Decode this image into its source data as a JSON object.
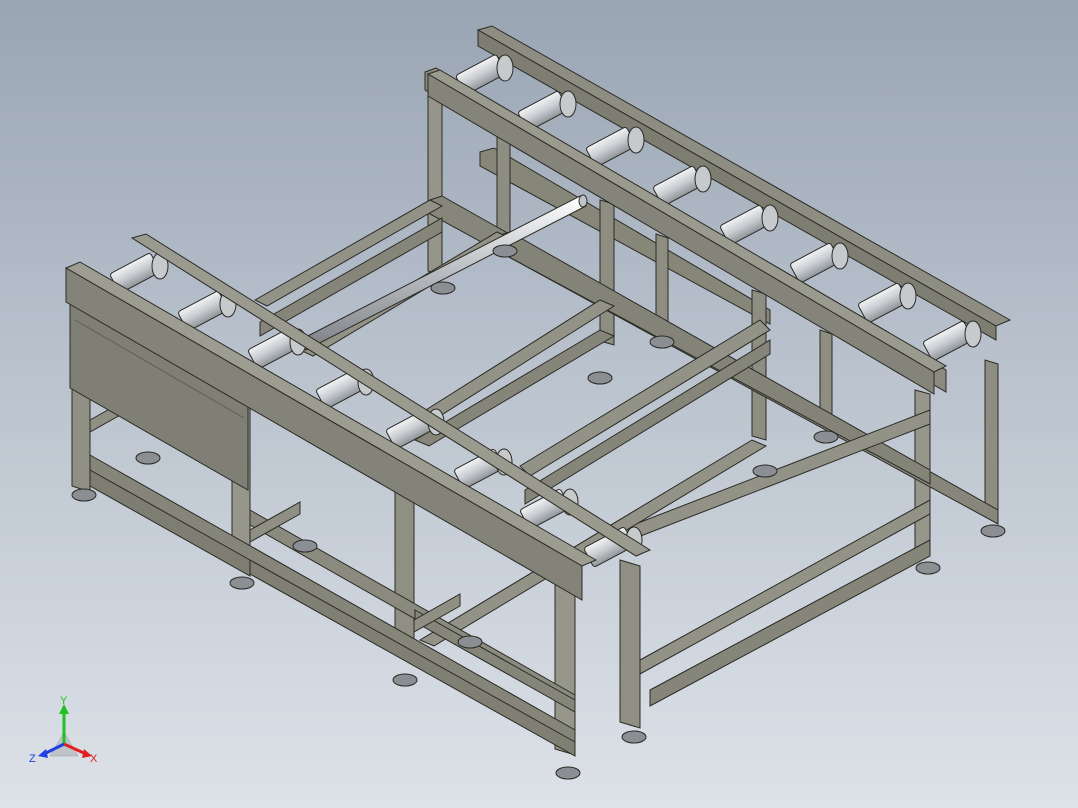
{
  "viewport": {
    "background_top": "#9aa5b4",
    "background_bottom": "#dde2e8"
  },
  "model": {
    "frame_color": "#8d8d82",
    "frame_edge_color": "#2b2b26",
    "roller_color": "#d6d9dc",
    "panel_color": "#7f7f75",
    "foot_color": "#7a7c80"
  },
  "triad": {
    "x_label": "X",
    "y_label": "Y",
    "z_label": "Z",
    "x_color": "#e02020",
    "y_color": "#1ec21e",
    "z_color": "#2040e0"
  }
}
